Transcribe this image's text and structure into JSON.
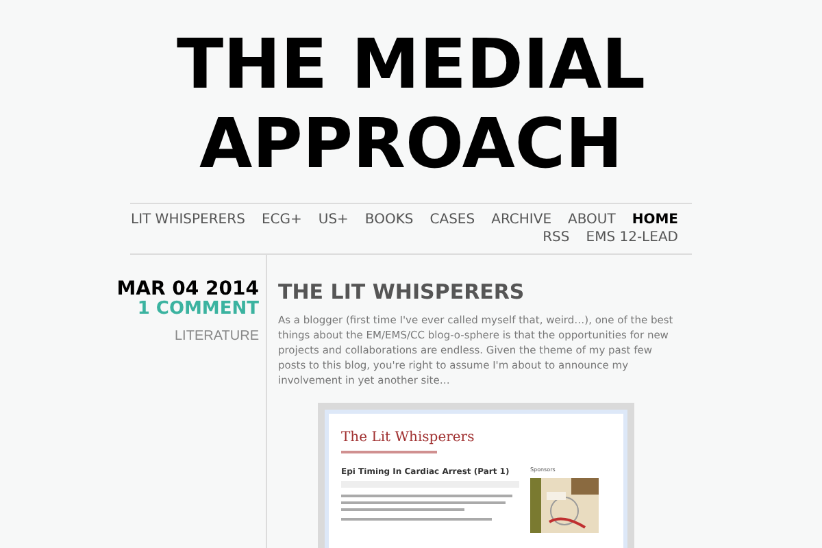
{
  "site_title": "THE MEDIAL APPROACH",
  "nav": [
    {
      "label": "LIT WHISPERERS",
      "selected": false
    },
    {
      "label": "ECG+",
      "selected": false
    },
    {
      "label": "US+",
      "selected": false
    },
    {
      "label": "BOOKS",
      "selected": false
    },
    {
      "label": "CASES",
      "selected": false
    },
    {
      "label": "ARCHIVE",
      "selected": false
    },
    {
      "label": "ABOUT",
      "selected": false
    },
    {
      "label": "HOME",
      "selected": true
    },
    {
      "label": "RSS",
      "selected": false
    },
    {
      "label": "EMS 12-LEAD",
      "selected": false
    }
  ],
  "post": {
    "date": "MAR 04 2014",
    "comments": "1 COMMENT",
    "category": "LITERATURE",
    "title": "THE LIT WHISPERERS",
    "body": "As a blogger (first time I've ever called myself that, weird…), one of the best things about the EM/EMS/CC blog-o-sphere is that the opportunities for new projects and collaborations are endless. Given the theme of my past few posts to this blog, you're right to assume I'm about to announce my involvement in yet another site…",
    "screenshot": {
      "blog_title": "The Lit Whisperers",
      "post_title": "Epi Timing In Cardiac Arrest (Part 1)",
      "sidebar_heading": "Sponsors"
    }
  }
}
